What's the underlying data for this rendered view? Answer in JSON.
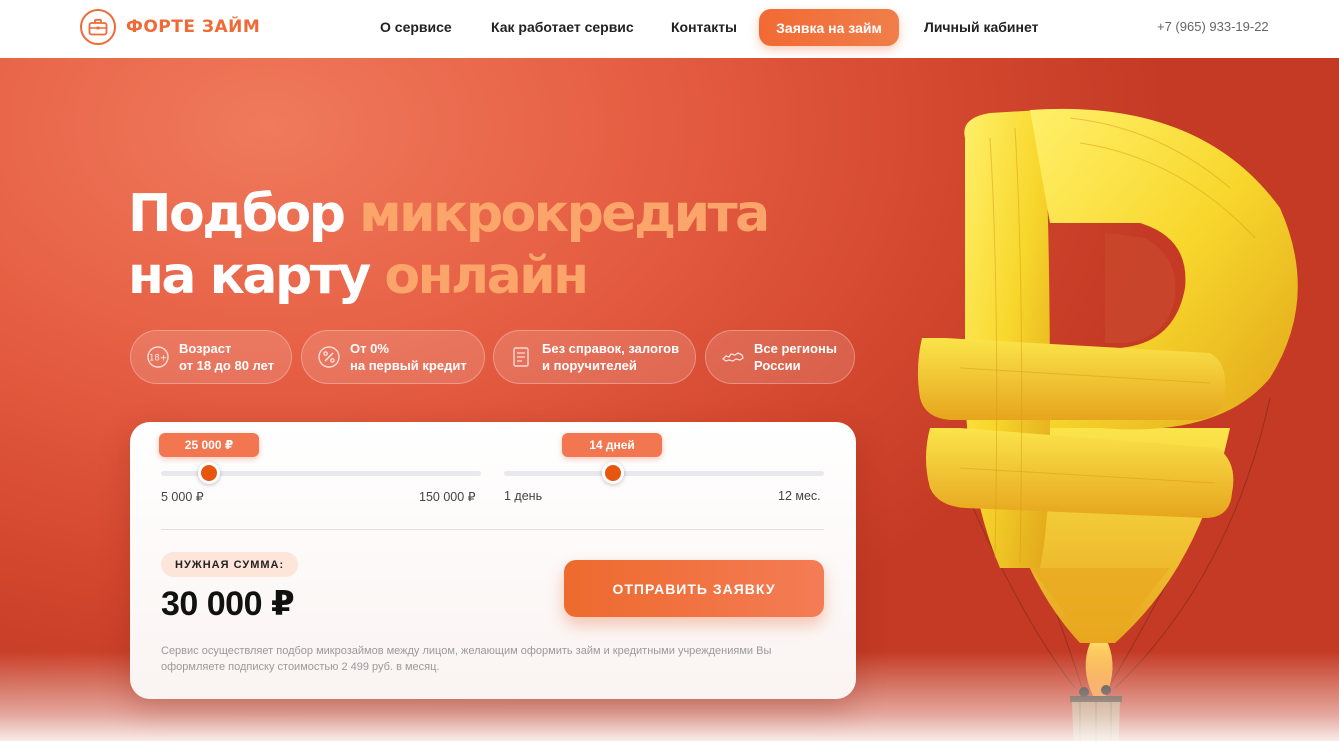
{
  "header": {
    "logo_text": "ФОРТЕ ЗАЙМ",
    "nav": [
      {
        "label": "О сервисе"
      },
      {
        "label": "Как работает сервис"
      },
      {
        "label": "Контакты"
      },
      {
        "label": "Личный кабинет"
      }
    ],
    "cta_label": "Заявка на займ",
    "phone": "+7 (965) 933-19-22"
  },
  "hero": {
    "title_line1_plain": "Подбор ",
    "title_line1_highlight": "микрокредита",
    "title_line2_plain": "на карту ",
    "title_line2_highlight": "онлайн",
    "badges": [
      {
        "icon": "age-18-icon",
        "line1": "Возраст",
        "line2": "от 18 до 80 лет"
      },
      {
        "icon": "percent-icon",
        "line1": "От 0%",
        "line2": "на первый кредит"
      },
      {
        "icon": "document-icon",
        "line1": "Без справок, залогов",
        "line2": "и поручителей"
      },
      {
        "icon": "russia-map-icon",
        "line1": "Все регионы",
        "line2": "России"
      }
    ]
  },
  "calculator": {
    "amount": {
      "bubble": "25 000 ₽",
      "min_label": "5 000 ₽",
      "max_label": "150 000 ₽",
      "value_fraction": 0.15
    },
    "term": {
      "bubble": "14 дней",
      "min_label": "1 день",
      "max_label": "12 мес.",
      "value_fraction": 0.34
    },
    "sum_label": "НУЖНАЯ СУММА:",
    "sum_value": "30 000 ₽",
    "submit_label": "ОТПРАВИТЬ ЗАЯВКУ",
    "disclaimer": "Сервис осуществляет подбор микрозаймов между лицом, желающим оформить займ и кредитными учреждениями Вы оформляете подписку стоимостью 2 499 руб. в месяц."
  },
  "colors": {
    "accent": "#ee6a36",
    "hero_bg": "#d8502f",
    "highlight": "#fba56a",
    "thumb": "#e8550f"
  }
}
